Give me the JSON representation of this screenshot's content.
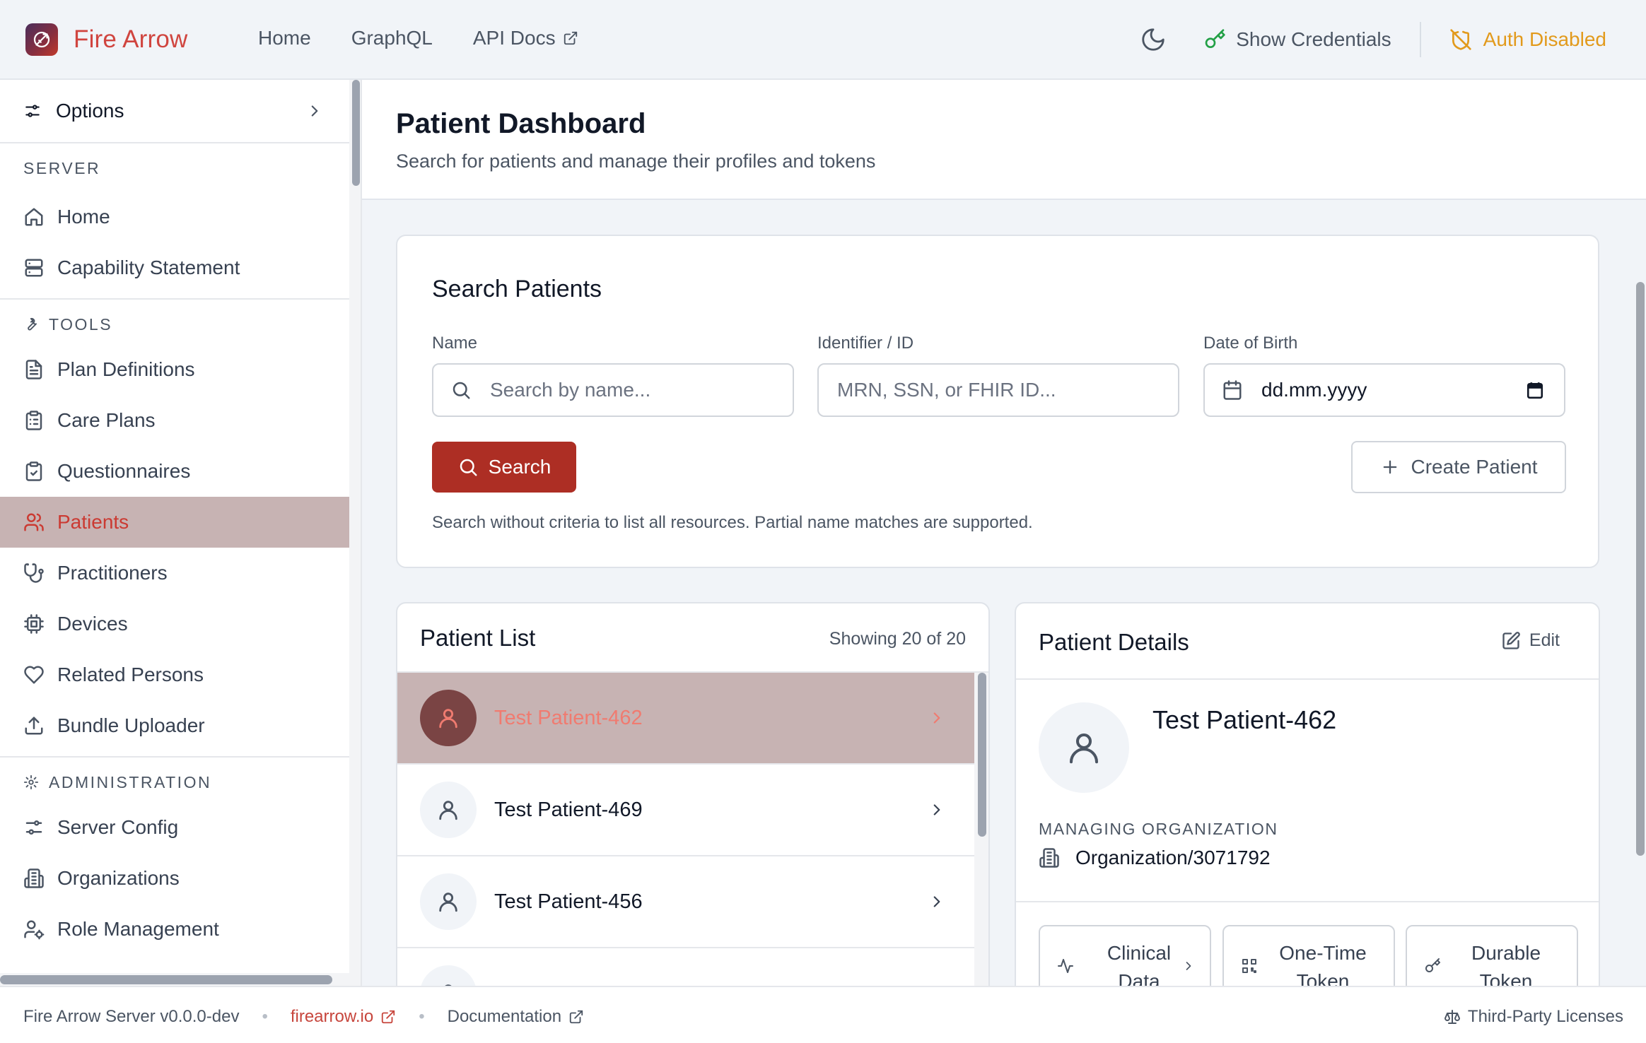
{
  "header": {
    "brand": "Fire Arrow",
    "nav": [
      {
        "label": "Home"
      },
      {
        "label": "GraphQL"
      },
      {
        "label": "API Docs"
      }
    ],
    "show_credentials": "Show Credentials",
    "auth_status": "Auth Disabled",
    "colors": {
      "brand": "#d0453f",
      "auth_warning": "#e29a1c",
      "key_green": "#22a046"
    }
  },
  "sidebar": {
    "options_label": "Options",
    "sections": [
      {
        "title": "SERVER",
        "items": [
          {
            "label": "Home",
            "icon": "home-icon"
          },
          {
            "label": "Capability Statement",
            "icon": "server-icon"
          }
        ]
      },
      {
        "title": "TOOLS",
        "items": [
          {
            "label": "Plan Definitions",
            "icon": "file-text-icon"
          },
          {
            "label": "Care Plans",
            "icon": "clipboard-list-icon"
          },
          {
            "label": "Questionnaires",
            "icon": "clipboard-check-icon"
          },
          {
            "label": "Patients",
            "icon": "users-icon",
            "active": true
          },
          {
            "label": "Practitioners",
            "icon": "stethoscope-icon"
          },
          {
            "label": "Devices",
            "icon": "cpu-icon"
          },
          {
            "label": "Related Persons",
            "icon": "heart-icon"
          },
          {
            "label": "Bundle Uploader",
            "icon": "upload-icon"
          }
        ]
      },
      {
        "title": "ADMINISTRATION",
        "items": [
          {
            "label": "Server Config",
            "icon": "sliders-icon"
          },
          {
            "label": "Organizations",
            "icon": "building-icon"
          },
          {
            "label": "Role Management",
            "icon": "user-cog-icon"
          }
        ]
      }
    ]
  },
  "page": {
    "title": "Patient Dashboard",
    "subtitle": "Search for patients and manage their profiles and tokens"
  },
  "search": {
    "title": "Search Patients",
    "name_label": "Name",
    "name_placeholder": "Search by name...",
    "identifier_label": "Identifier / ID",
    "identifier_placeholder": "MRN, SSN, or FHIR ID...",
    "dob_label": "Date of Birth",
    "dob_value": "dd.mm.yyyy",
    "search_button": "Search",
    "create_button": "Create Patient",
    "hint": "Search without criteria to list all resources. Partial name matches are supported."
  },
  "patient_list": {
    "title": "Patient List",
    "count": "Showing 20 of 20",
    "patients": [
      {
        "name": "Test Patient-462",
        "selected": true
      },
      {
        "name": "Test Patient-469"
      },
      {
        "name": "Test Patient-456"
      },
      {
        "name": ""
      }
    ]
  },
  "patient_details": {
    "title": "Patient Details",
    "edit_label": "Edit",
    "name": "Test Patient-462",
    "org_label": "MANAGING ORGANIZATION",
    "org_value": "Organization/3071792",
    "actions": [
      {
        "line1": "Clinical",
        "line2": "Data",
        "icon": "activity-icon"
      },
      {
        "line1": "One-Time",
        "line2": "Token",
        "icon": "qr-code-icon"
      },
      {
        "line1": "Durable",
        "line2": "Token",
        "icon": "key-icon"
      }
    ]
  },
  "footer": {
    "version": "Fire Arrow Server v0.0.0-dev",
    "site_link": "firearrow.io",
    "docs_link": "Documentation",
    "licenses": "Third-Party Licenses"
  }
}
